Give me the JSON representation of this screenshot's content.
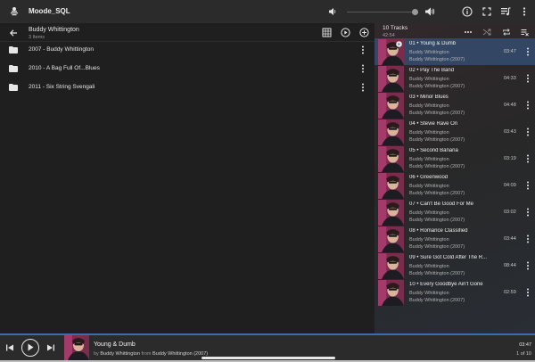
{
  "app": {
    "title": "Moode_SQL"
  },
  "browse": {
    "artist": "Buddy Whittington",
    "item_count": "3 Items",
    "albums": [
      {
        "name": "2007 - Buddy Whittington"
      },
      {
        "name": "2010 - A Bag Full Of...Blues"
      },
      {
        "name": "2011 - Six String Svengali"
      }
    ]
  },
  "queue": {
    "title": "10 Tracks",
    "duration": "42:54",
    "current_index": 0,
    "tracks": [
      {
        "title": "01 • Young & Dumb",
        "artist": "Buddy Whittington",
        "album": "Buddy Whittington (2007)",
        "duration": "03:47"
      },
      {
        "title": "02 • Pay The Band",
        "artist": "Buddy Whittington",
        "album": "Buddy Whittington (2007)",
        "duration": "04:33"
      },
      {
        "title": "03 • Minor Blues",
        "artist": "Buddy Whittington",
        "album": "Buddy Whittington (2007)",
        "duration": "04:48"
      },
      {
        "title": "04 • Stevie Rave On",
        "artist": "Buddy Whittington",
        "album": "Buddy Whittington (2007)",
        "duration": "03:43"
      },
      {
        "title": "05 • Second Banana",
        "artist": "Buddy Whittington",
        "album": "Buddy Whittington (2007)",
        "duration": "03:19"
      },
      {
        "title": "06 • Greenwood",
        "artist": "Buddy Whittington",
        "album": "Buddy Whittington (2007)",
        "duration": "04:09"
      },
      {
        "title": "07 • Can't Be Good For Me",
        "artist": "Buddy Whittington",
        "album": "Buddy Whittington (2007)",
        "duration": "03:02"
      },
      {
        "title": "08 • Romance Classified",
        "artist": "Buddy Whittington",
        "album": "Buddy Whittington (2007)",
        "duration": "03:44"
      },
      {
        "title": "09 • Sure Got Cold After The R...",
        "artist": "Buddy Whittington",
        "album": "Buddy Whittington (2007)",
        "duration": "08:44"
      },
      {
        "title": "10 • Every Goodbye Ain't Gone",
        "artist": "Buddy Whittington",
        "album": "Buddy Whittington (2007)",
        "duration": "02:59"
      }
    ]
  },
  "now_playing": {
    "title": "Young & Dumb",
    "by_label": "by",
    "artist": "Buddy Whittington",
    "from_label": "from",
    "album": "Buddy Whittington (2007)",
    "time": "03:47",
    "position": "1 of 10"
  },
  "volume": {
    "level": 0.95
  },
  "colors": {
    "accent": "#3d6da6",
    "background": "#1f1f1f",
    "bar": "#2b2b2b"
  }
}
